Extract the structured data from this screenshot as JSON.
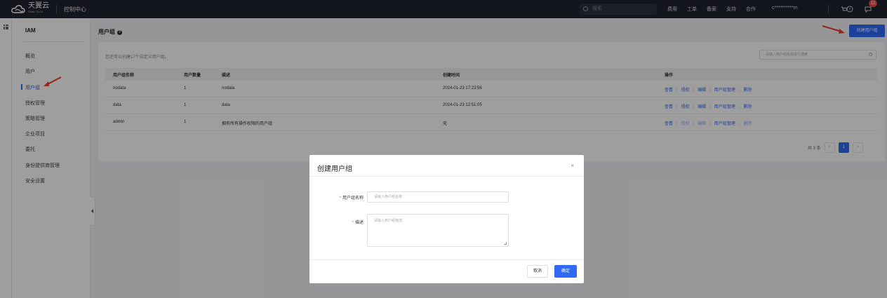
{
  "topbar": {
    "logo_cn": "天翼云",
    "logo_en": "State Cloud",
    "console": "控制中心",
    "search_placeholder": "搜索",
    "links": [
      "费用",
      "工单",
      "备案",
      "支持",
      "合作"
    ],
    "user": "c**********m",
    "notification_count": "12"
  },
  "sidebar": {
    "title": "IAM",
    "items": [
      {
        "label": "概览"
      },
      {
        "label": "用户"
      },
      {
        "label": "用户组"
      },
      {
        "label": "授权管理"
      },
      {
        "label": "策略管理"
      },
      {
        "label": "企业项目"
      },
      {
        "label": "委托"
      },
      {
        "label": "身份提供商管理"
      },
      {
        "label": "安全设置"
      }
    ],
    "active_index": 2
  },
  "main": {
    "title": "用户组",
    "create_button": "创建用户组",
    "info": "您还可以创建17个自定义用户组。",
    "search_placeholder": "请输入用户组名称进行搜索",
    "columns": [
      "用户组名称",
      "用户数量",
      "描述",
      "创建时间",
      "操作"
    ],
    "rows": [
      {
        "name": "nodata",
        "count": "1",
        "desc": "nodata",
        "created": "2024-01-23 17:23:56"
      },
      {
        "name": "data",
        "count": "1",
        "desc": "data",
        "created": "2024-01-23 12:51:05"
      },
      {
        "name": "admin",
        "count": "1",
        "desc": "拥有所有操作权限的用户组",
        "created": "无"
      }
    ],
    "ops": [
      "查看",
      "授权",
      "编辑",
      "用户组管理",
      "删除"
    ],
    "pager_total": "共 3 条",
    "pager_prev": "<",
    "pager_current": "1",
    "pager_next": ">"
  },
  "modal": {
    "title": "创建用户组",
    "close": "×",
    "name_label": "用户组名称",
    "name_placeholder": "请输入用户组名称",
    "desc_label": "描述",
    "desc_placeholder": "请输入用户组描述",
    "required_mark": "*",
    "cancel": "取消",
    "ok": "确定"
  },
  "colors": {
    "accent": "#3069f5",
    "topbar": "#1f2430",
    "badge": "#f04f4f",
    "arrow": "#f03c2e"
  }
}
